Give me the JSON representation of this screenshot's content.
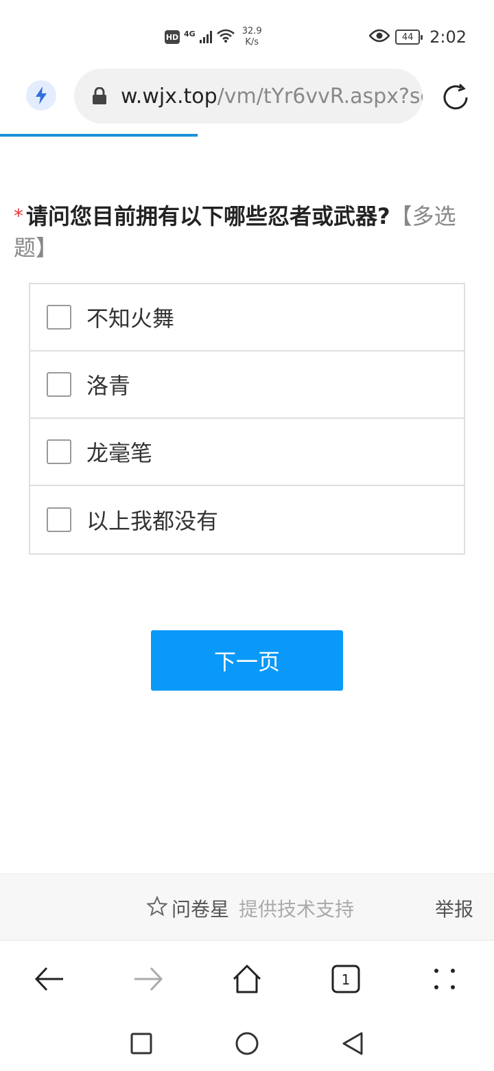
{
  "status_bar": {
    "hd": "HD",
    "network_type": "4G",
    "speed_value": "32.9",
    "speed_unit": "K/s",
    "battery": "44",
    "time": "2:02"
  },
  "browser": {
    "url_domain": "w.wjx.top",
    "url_path": "/vm/tYr6vvR.aspx?sc",
    "load_progress": 0.4
  },
  "question": {
    "required_mark": "*",
    "title": "请问您目前拥有以下哪些忍者或武器?",
    "type_tag": "【多选题】",
    "options": [
      {
        "label": "不知火舞",
        "checked": false
      },
      {
        "label": "洛青",
        "checked": false
      },
      {
        "label": "龙毫笔",
        "checked": false
      },
      {
        "label": "以上我都没有",
        "checked": false
      }
    ]
  },
  "next_button": "下一页",
  "footer": {
    "brand_name": "问卷星",
    "support_text": "提供技术支持",
    "report": "举报"
  },
  "browser_nav": {
    "tab_count": "1"
  },
  "colors": {
    "accent": "#0a99f8",
    "progress": "#1a8ed8",
    "required": "#e23b3b"
  }
}
